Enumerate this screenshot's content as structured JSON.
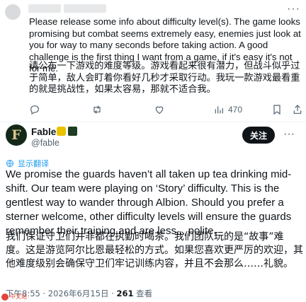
{
  "tweet1": {
    "text_en": "Please release some info about difficulty level(s). The game looks promising but combat seems extremely easy, enemies just look at you for way to many seconds before taking action. A good challenge is the first thing I want from a game, if it's easy it's not for me.",
    "text_cn": "请公布一下游戏的难度等级。游戏看起来很有潜力，但战斗似乎过于简单，敌人会盯着你看好几秒才采取行动。我玩一款游戏最看重的就是挑战性，如果太容易，那就不适合我。",
    "more": "···",
    "views": "470"
  },
  "tweet2": {
    "avatar_letter": "F",
    "display_name": "Fable",
    "handle": "@fable",
    "follow_label": "关注",
    "more": "···",
    "translate_label": "显示翻译",
    "text_en": "We promise the guards haven’t all taken up tea drinking mid-shift. Our team were playing on ‘Story’ difficulty. This is the gentlest way to wander through Albion. Should you prefer a sterner welcome, other difficulty levels will ensure the guards remember their training and are less... polite.",
    "text_cn": "我们保证守卫们并非都在执勤时喝茶。我们团队玩的是“故事”难度。这是游览阿尔比恩最轻松的方式。如果您喜欢更严厉的欢迎，其他难度级别会确保守卫们牢记训练内容，并且不会那么……礼貌。",
    "time": "下午8:55 · 2026年6月15日 · ",
    "views_count": "261",
    "views_label": " 查看"
  },
  "watermark": "中文站"
}
